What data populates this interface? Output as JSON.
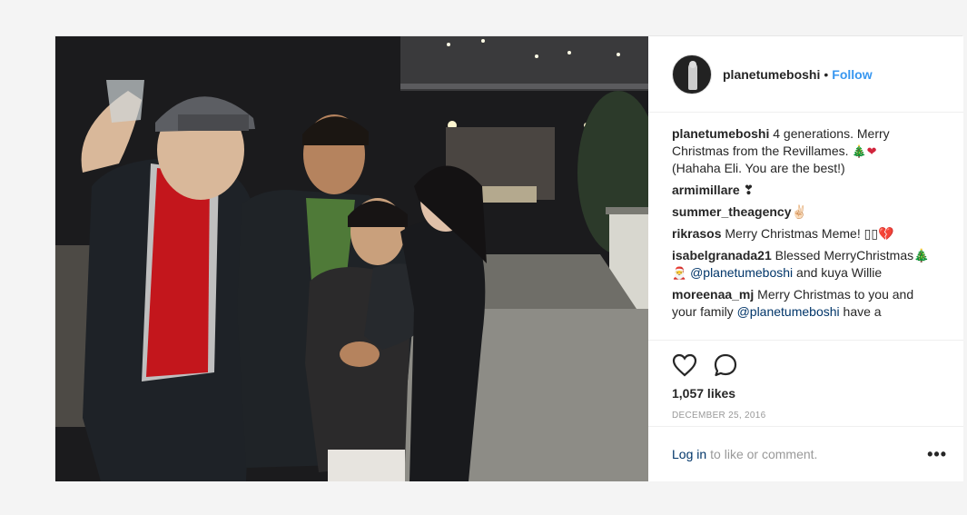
{
  "post": {
    "username": "planetumeboshi",
    "dot": "•",
    "follow_label": "Follow",
    "caption_user": "planetumeboshi",
    "caption_text": " 4 generations. Merry Christmas from the Revillames. ",
    "caption_tail": "(Hahaha Eli. You are the best!)",
    "caption_emoji_tree": "🎄",
    "caption_emoji_heart": "❤",
    "comments": [
      {
        "user": "armimillare",
        "text": " ❣"
      },
      {
        "user": "summer_theagency",
        "text": "✌🏻"
      },
      {
        "user": "rikrasos",
        "text": " Merry Christmas Meme! ▯▯💔"
      },
      {
        "user": "isabelgranada21",
        "text": " Blessed MerryChristmas🎄",
        "text2": " ",
        "mention": "@planetumeboshi",
        "text3": " and kuya Willie",
        "santa": "🎅"
      },
      {
        "user": "moreenaa_mj",
        "text": " Merry Christmas to you and your family ",
        "mention": "@planetumeboshi",
        "text3": " have a"
      }
    ],
    "likes": "1,057 likes",
    "date": "DECEMBER 25, 2016",
    "login_link": "Log in",
    "login_rest": "to like or comment.",
    "more": "•••"
  },
  "icons": {
    "like": "heart-outline-icon",
    "comment": "speech-bubble-icon",
    "more": "more-options-icon"
  },
  "colors": {
    "link": "#3897f0",
    "mention": "#003569",
    "muted": "#999999"
  }
}
